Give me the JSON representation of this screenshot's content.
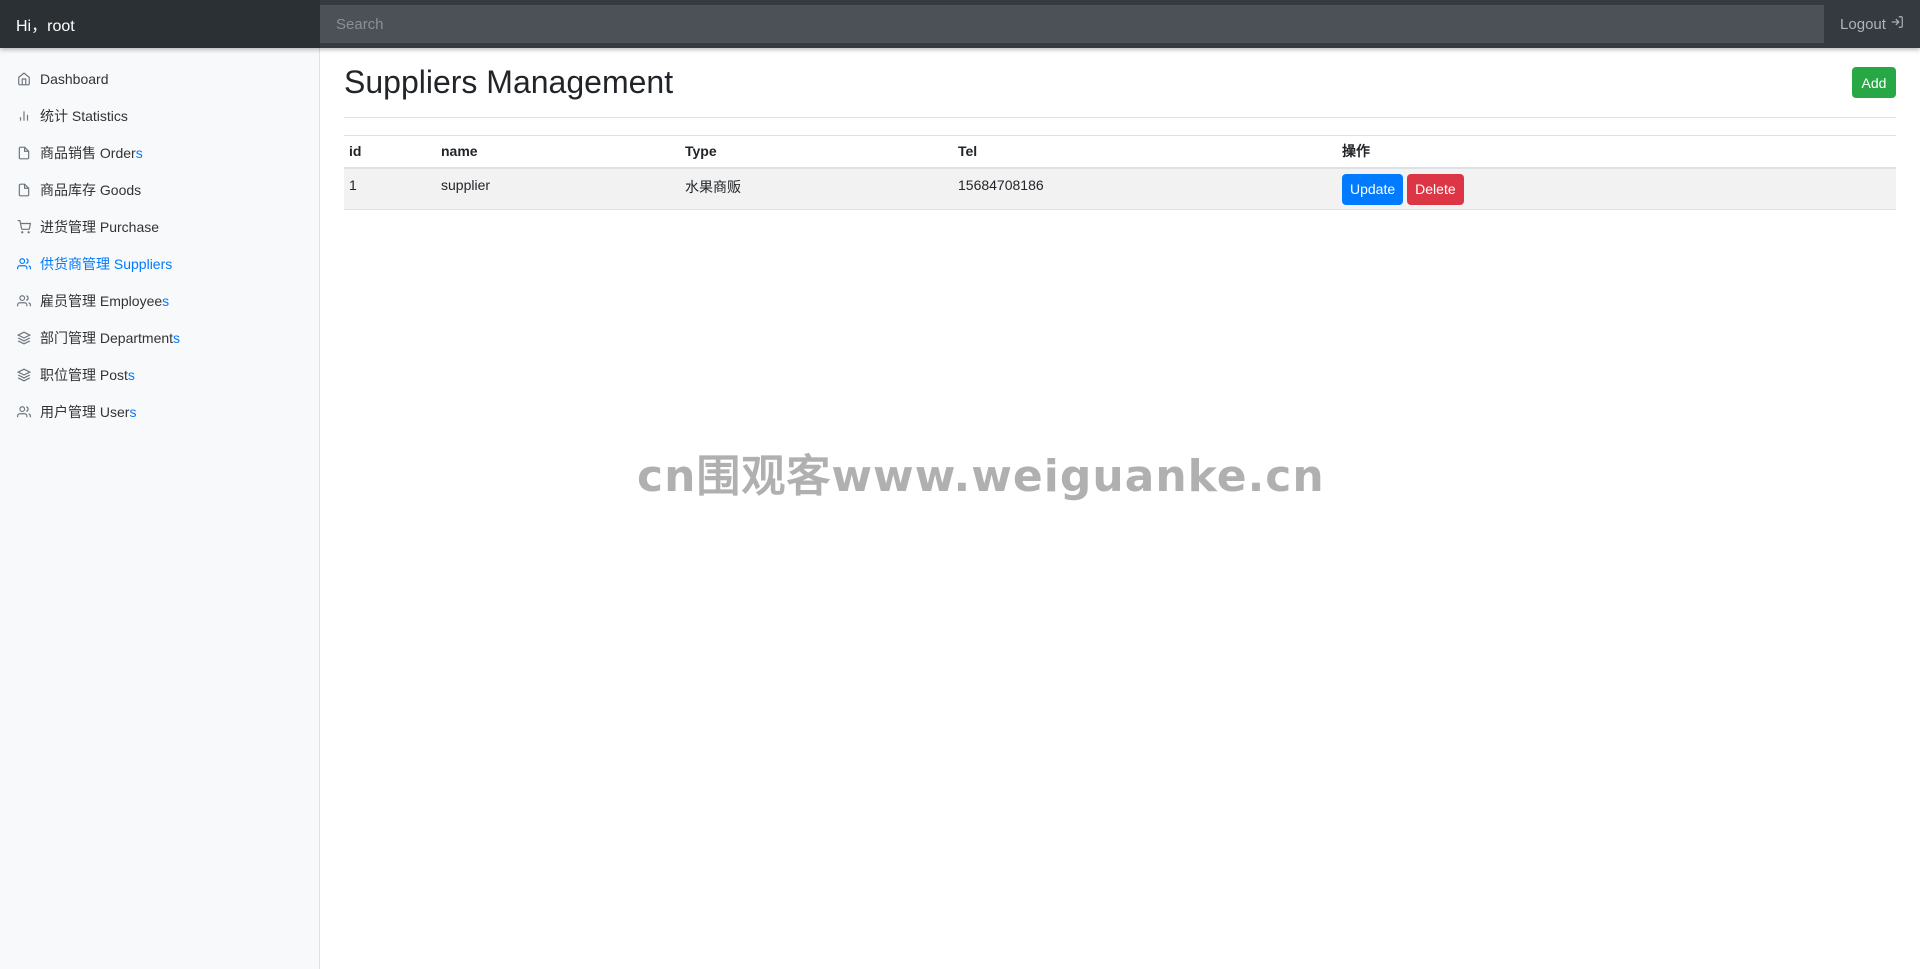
{
  "topbar": {
    "greeting": "Hi，root",
    "search_placeholder": "Search",
    "logout_label": "Logout"
  },
  "sidebar": {
    "items": [
      {
        "label": "Dashboard",
        "suffix": "",
        "icon": "home-icon",
        "active": false
      },
      {
        "label": "统计 Statistics",
        "suffix": "",
        "icon": "bar-chart-icon",
        "active": false
      },
      {
        "label": "商品销售 Order",
        "suffix": "s",
        "icon": "file-icon",
        "active": false
      },
      {
        "label": "商品库存 Goods",
        "suffix": "",
        "icon": "file-icon",
        "active": false
      },
      {
        "label": "进货管理 Purchase",
        "suffix": "",
        "icon": "cart-icon",
        "active": false
      },
      {
        "label": "供货商管理 Suppliers",
        "suffix": "",
        "icon": "users-icon",
        "active": true
      },
      {
        "label": "雇员管理 Employee",
        "suffix": "s",
        "icon": "users-icon",
        "active": false
      },
      {
        "label": "部门管理 Department",
        "suffix": "s",
        "icon": "layers-icon",
        "active": false
      },
      {
        "label": "职位管理 Post",
        "suffix": "s",
        "icon": "layers-icon",
        "active": false
      },
      {
        "label": "用户管理 User",
        "suffix": "s",
        "icon": "users-icon",
        "active": false
      }
    ]
  },
  "main": {
    "title": "Suppliers Management",
    "add_label": "Add",
    "table": {
      "headers": [
        "id",
        "name",
        "Type",
        "Tel",
        "操作"
      ],
      "rows": [
        {
          "id": "1",
          "name": "supplier",
          "type": "水果商贩",
          "tel": "15684708186"
        }
      ],
      "update_label": "Update",
      "delete_label": "Delete"
    }
  },
  "watermark": "cn围观客www.weiguanke.cn",
  "colors": {
    "primary": "#007bff",
    "success": "#28a745",
    "danger": "#dc3545",
    "topbar": "#343a40"
  }
}
